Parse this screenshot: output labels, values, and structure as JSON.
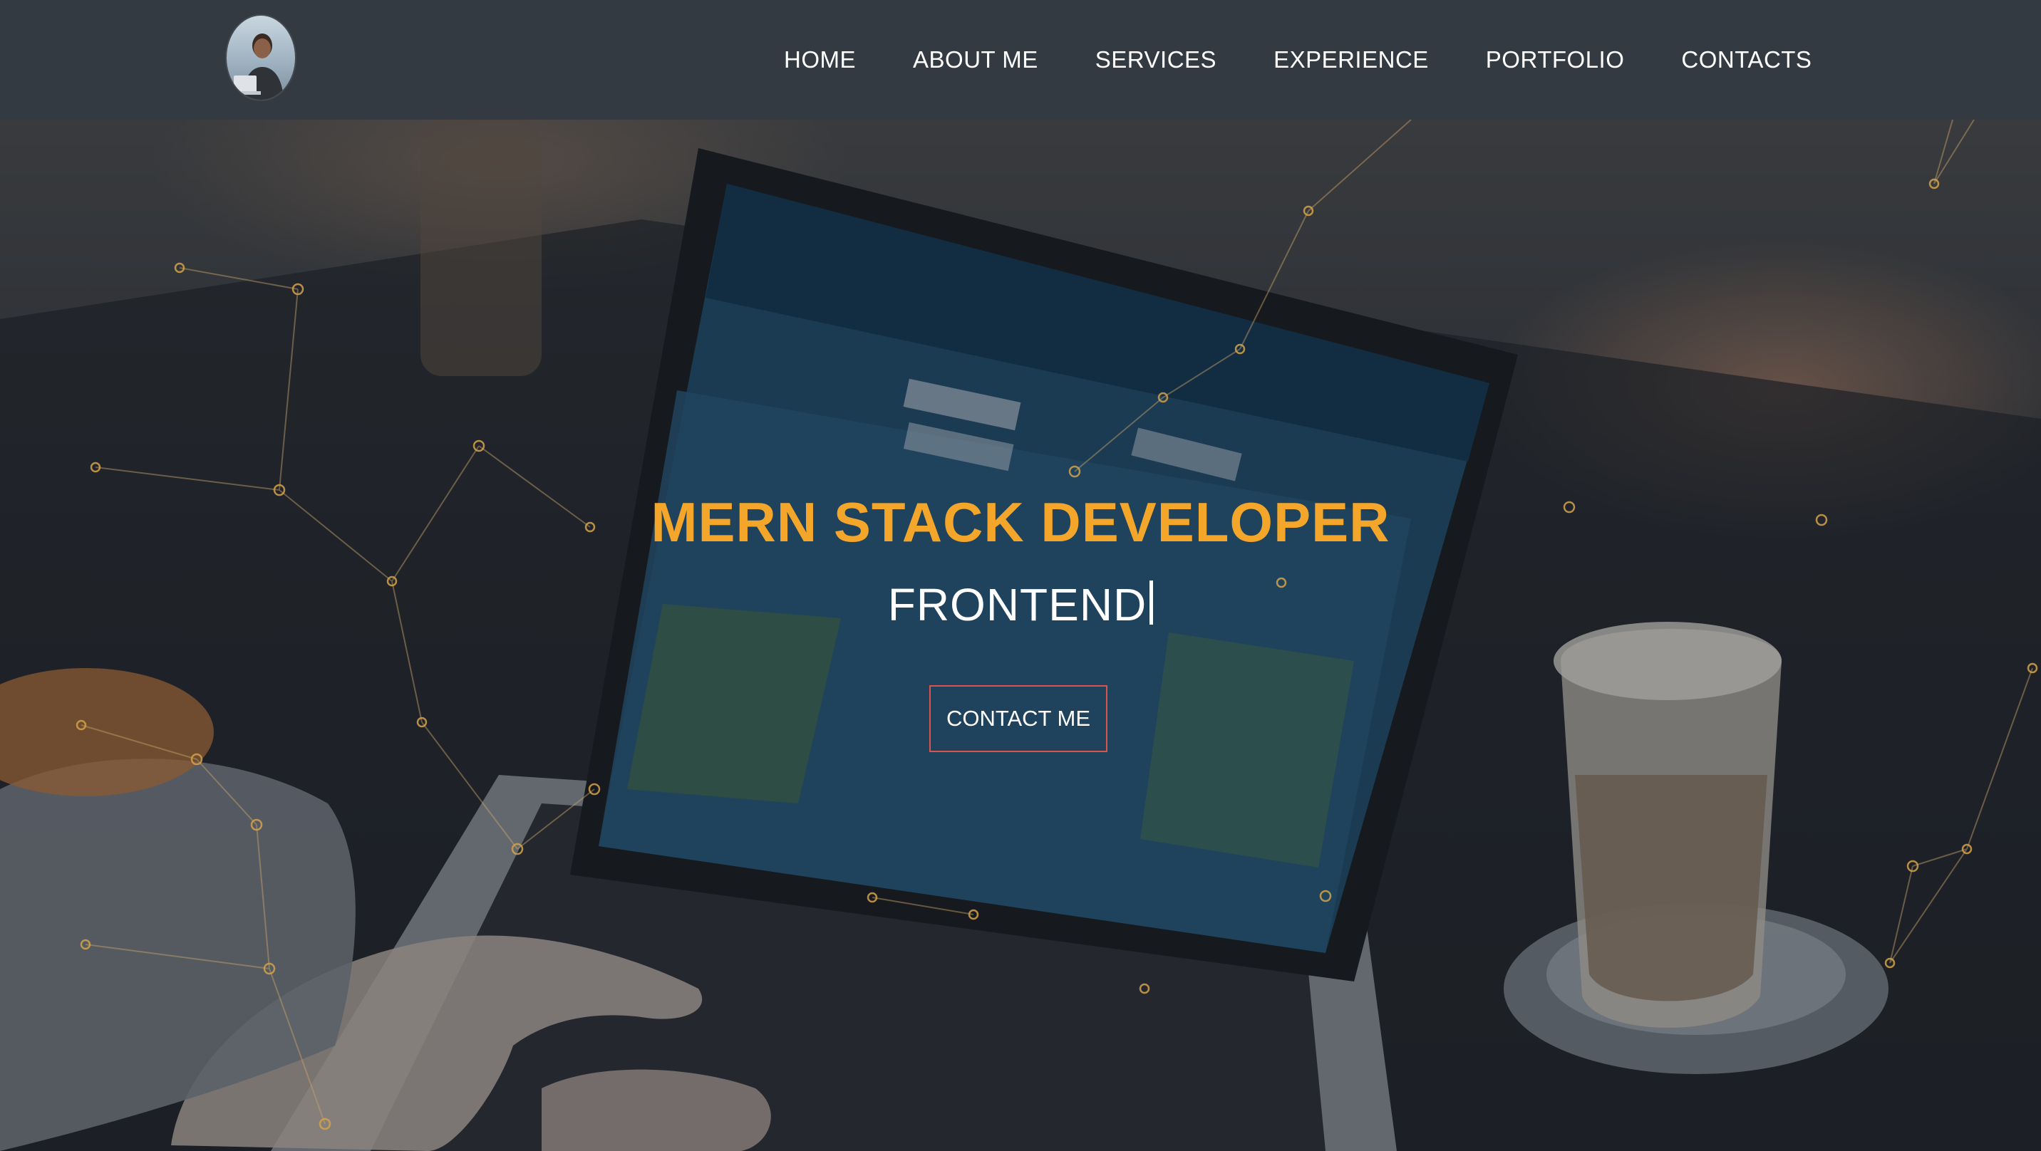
{
  "nav": {
    "links": [
      "HOME",
      "ABOUT ME",
      "SERVICES",
      "EXPERIENCE",
      "PORTFOLIO",
      "CONTACTS"
    ]
  },
  "hero": {
    "title": "MERN STACK DEVELOPER",
    "subtitle": "FRONTEND",
    "cta_label": "CONTACT ME"
  },
  "colors": {
    "navbar_bg": "#343a42",
    "title_accent": "#f4a62a",
    "button_border": "#d9534f",
    "particle": "#d4a24a"
  },
  "icons": {
    "avatar": "profile-photo-avatar"
  }
}
